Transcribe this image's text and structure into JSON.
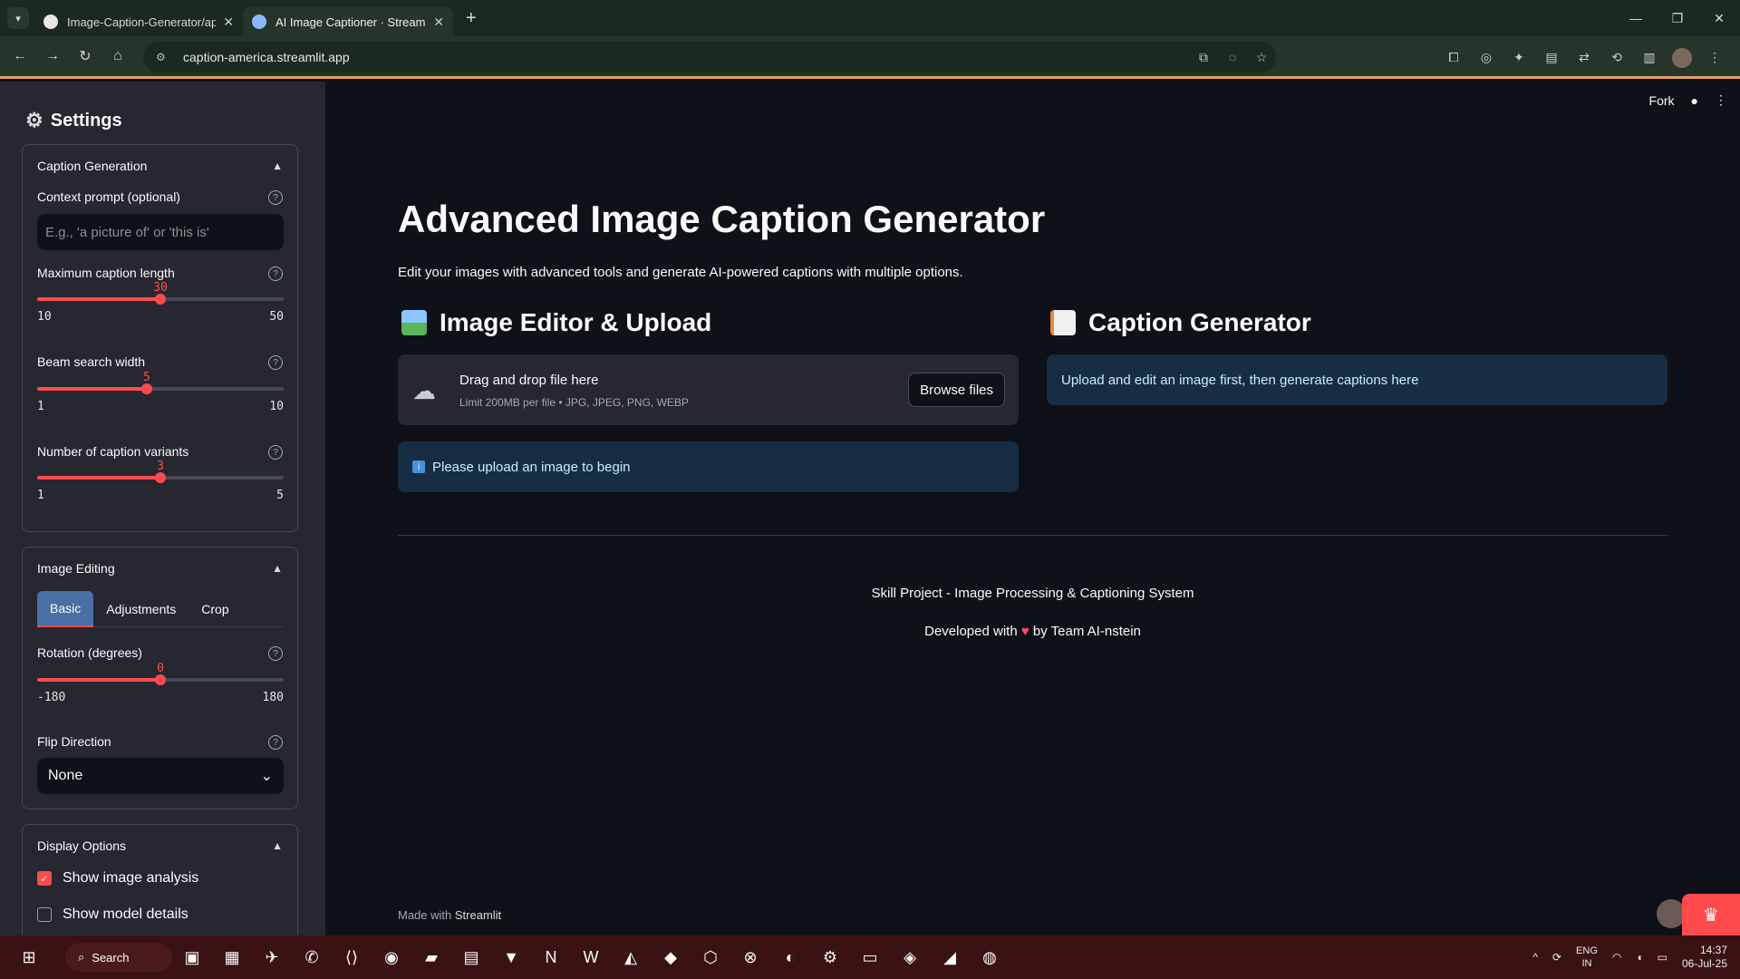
{
  "browser": {
    "tabs": [
      {
        "title": "Image-Caption-Generator/app"
      },
      {
        "title": "AI Image Captioner · Streamlit"
      }
    ],
    "url": "caption-america.streamlit.app"
  },
  "sidebar": {
    "title": "Settings",
    "caption_generation": {
      "header": "Caption Generation",
      "context_label": "Context prompt (optional)",
      "context_placeholder": "E.g., 'a picture of' or 'this is'",
      "max_len": {
        "label": "Maximum caption length",
        "value": "30",
        "min": "10",
        "max": "50",
        "v": 30,
        "lo": 10,
        "hi": 50
      },
      "beam": {
        "label": "Beam search width",
        "value": "5",
        "min": "1",
        "max": "10",
        "v": 5,
        "lo": 1,
        "hi": 10
      },
      "variants": {
        "label": "Number of caption variants",
        "value": "3",
        "min": "1",
        "max": "5",
        "v": 3,
        "lo": 1,
        "hi": 5
      }
    },
    "image_editing": {
      "header": "Image Editing",
      "tabs": [
        "Basic",
        "Adjustments",
        "Crop"
      ],
      "rotation": {
        "label": "Rotation (degrees)",
        "value": "0",
        "min": "-180",
        "max": "180",
        "v": 0,
        "lo": -180,
        "hi": 180
      },
      "flip_label": "Flip Direction",
      "flip_value": "None"
    },
    "display_options": {
      "header": "Display Options",
      "show_analysis": "Show image analysis",
      "show_model": "Show model details"
    }
  },
  "main": {
    "fork": "Fork",
    "title": "Advanced Image Caption Generator",
    "subtitle": "Edit your images with advanced tools and generate AI-powered captions with multiple options.",
    "editor_header": "Image Editor & Upload",
    "upload_title": "Drag and drop file here",
    "upload_limit": "Limit 200MB per file • JPG, JPEG, PNG, WEBP",
    "browse": "Browse files",
    "upload_info": "Please upload an image to begin",
    "caption_header": "Caption Generator",
    "caption_info": "Upload and edit an image first, then generate captions here",
    "footer_line1": "Skill Project - Image Processing & Captioning System",
    "footer_pre": "Developed with",
    "footer_post": "by Team AI-nstein",
    "made_with": "Made with",
    "made_brand": "Streamlit"
  },
  "taskbar": {
    "search": "Search",
    "lang1": "ENG",
    "lang2": "IN",
    "time": "14:37",
    "date": "06-Jul-25"
  }
}
